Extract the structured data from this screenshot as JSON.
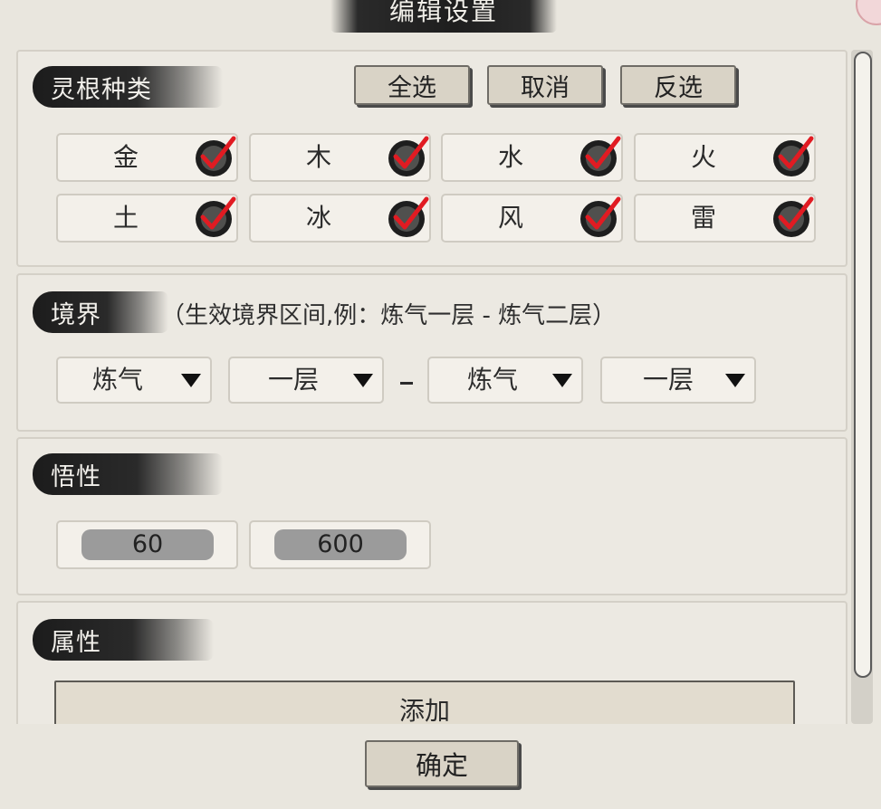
{
  "dialog": {
    "title": "编辑设置",
    "confirm_label": "确定"
  },
  "spirit_root": {
    "heading": "灵根种类",
    "buttons": {
      "select_all": "全选",
      "cancel": "取消",
      "invert": "反选"
    },
    "items": [
      {
        "label": "金",
        "checked": true
      },
      {
        "label": "木",
        "checked": true
      },
      {
        "label": "水",
        "checked": true
      },
      {
        "label": "火",
        "checked": true
      },
      {
        "label": "土",
        "checked": true
      },
      {
        "label": "冰",
        "checked": true
      },
      {
        "label": "风",
        "checked": true
      },
      {
        "label": "雷",
        "checked": true
      }
    ]
  },
  "realm": {
    "heading": "境界",
    "hint": "（生效境界区间,例：炼气一层 - 炼气二层）",
    "from_realm": "炼气",
    "from_layer": "一层",
    "to_realm": "炼气",
    "to_layer": "一层"
  },
  "comprehension": {
    "heading": "悟性",
    "min": "60",
    "max": "600"
  },
  "attribute": {
    "heading": "属性",
    "add_label": "添加"
  },
  "colors": {
    "check_red": "#e11b22",
    "ink": "#1e1e1e",
    "paper": "#ece9e2"
  },
  "icons": {
    "check": "check-mark-icon",
    "dropdown": "triangle-down-icon"
  }
}
